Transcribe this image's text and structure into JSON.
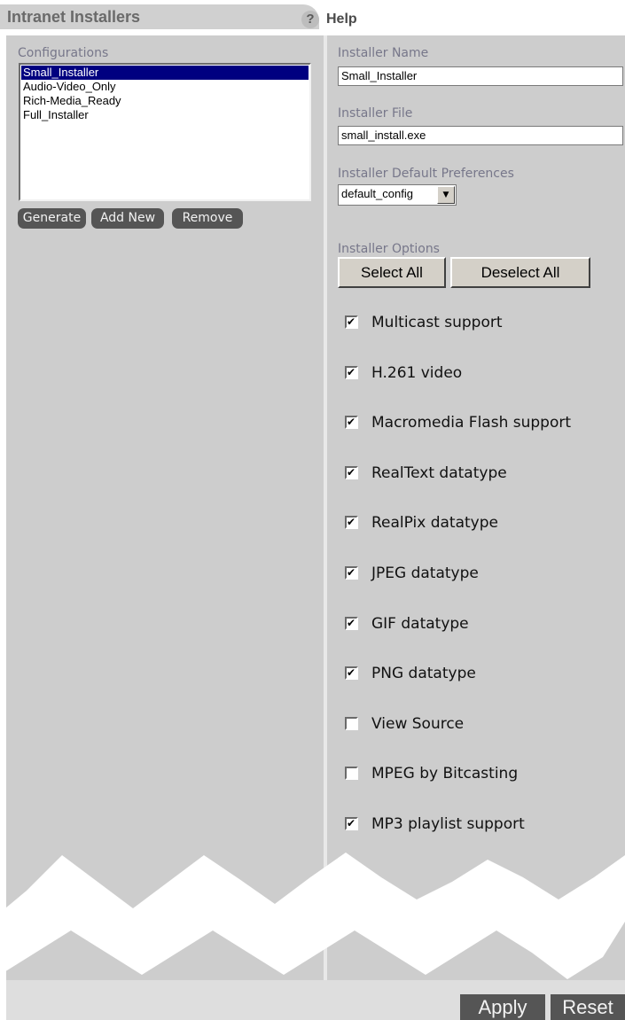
{
  "header": {
    "title": "Intranet Installers",
    "help_icon": "?",
    "help_label": "Help"
  },
  "configurations": {
    "label": "Configurations",
    "items": [
      {
        "label": "Small_Installer",
        "selected": true
      },
      {
        "label": "Audio-Video_Only",
        "selected": false
      },
      {
        "label": "Rich-Media_Ready",
        "selected": false
      },
      {
        "label": "Full_Installer",
        "selected": false
      }
    ],
    "buttons": {
      "generate": "Generate",
      "add_new": "Add New",
      "remove": "Remove"
    }
  },
  "installer": {
    "name_label": "Installer Name",
    "name_value": "Small_Installer",
    "file_label": "Installer File",
    "file_value": "small_install.exe",
    "prefs_label": "Installer Default Preferences",
    "prefs_value": "default_config",
    "options_label": "Installer Options",
    "select_all": "Select All",
    "deselect_all": "Deselect All",
    "options": [
      {
        "label": "Multicast support",
        "checked": true
      },
      {
        "label": "H.261 video",
        "checked": true
      },
      {
        "label": "Macromedia Flash support",
        "checked": true
      },
      {
        "label": "RealText datatype",
        "checked": true
      },
      {
        "label": "RealPix datatype",
        "checked": true
      },
      {
        "label": "JPEG datatype",
        "checked": true
      },
      {
        "label": "GIF datatype",
        "checked": true
      },
      {
        "label": "PNG datatype",
        "checked": true
      },
      {
        "label": "View Source",
        "checked": false
      },
      {
        "label": "MPEG by Bitcasting",
        "checked": false
      },
      {
        "label": "MP3 playlist support",
        "checked": true
      }
    ]
  },
  "footer": {
    "apply": "Apply",
    "reset": "Reset"
  },
  "colors": {
    "panel_bg": "#cdcdcd",
    "selection": "#000080",
    "dark_button": "#555555",
    "label_text": "#77778a"
  }
}
